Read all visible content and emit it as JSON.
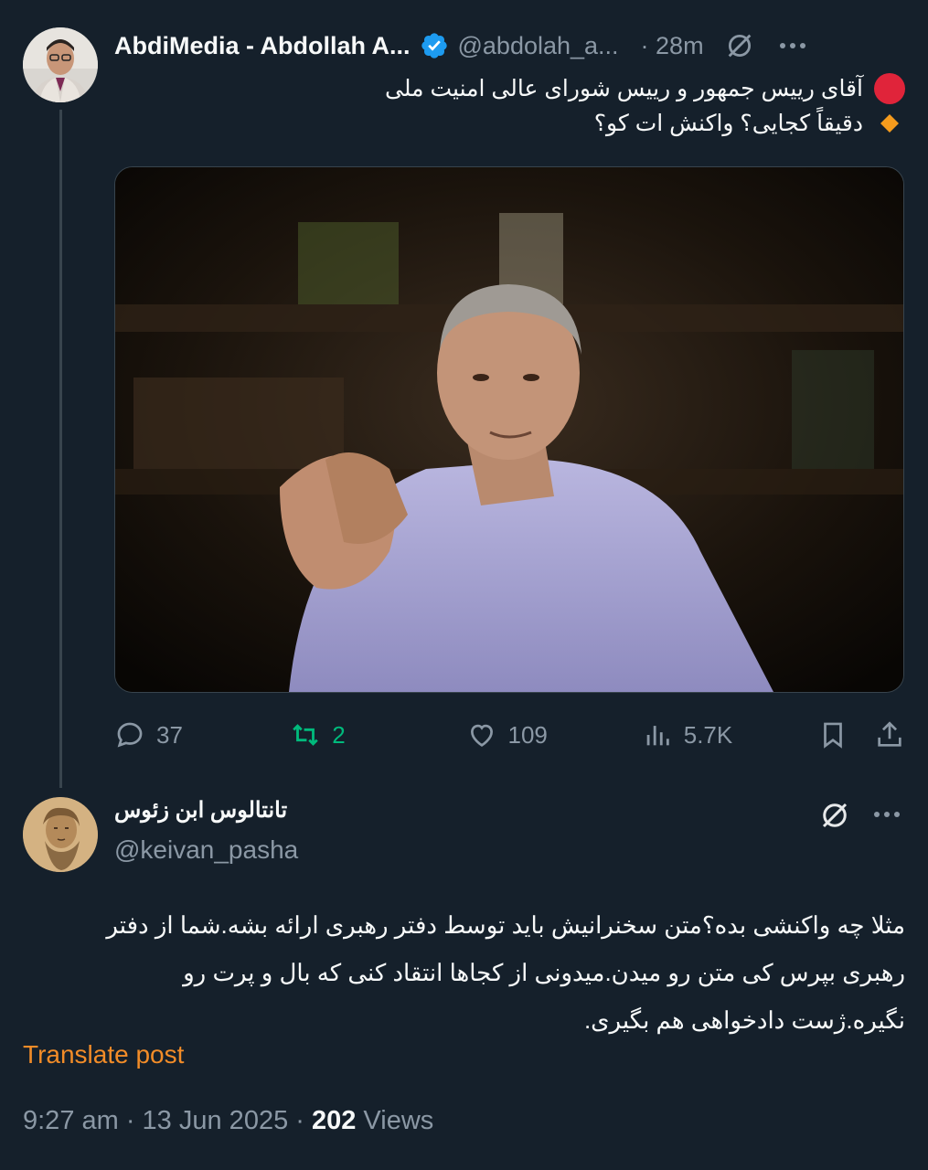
{
  "main_tweet": {
    "author_name": "AbdiMedia - Abdollah A...",
    "handle": "@abdolah_a...",
    "time": "· 28m",
    "lines": [
      {
        "emoji": "red-circle",
        "text": "آقای رییس جمهور و رییس شورای عالی امنیت ملی"
      },
      {
        "emoji": "orange-diamond",
        "text": "دقیقاً کجایی؟ واکنش ات کو؟"
      }
    ],
    "actions": {
      "replies": "37",
      "reposts": "2",
      "likes": "109",
      "views": "5.7K"
    }
  },
  "reply": {
    "author_name": "تانتالوس ابن زئوس",
    "handle": "@keivan_pasha",
    "lines": [
      "مثلا چه واکنشی بده؟متن سخنرانیش باید توسط دفتر رهبری ارائه بشه.شما از دفتر",
      "رهبری بپرس کی متن رو میدن.میدونی از کجاها انتقاد کنی که بال و پرت رو",
      "نگیره.ژست دادخواهی هم بگیری."
    ],
    "translate_label": "Translate post",
    "timestamp": "9:27 am · 13 Jun 2025 · ",
    "views_count": "202",
    "views_label": " Views"
  },
  "colors": {
    "background": "#15202b",
    "text": "#f7f9f9",
    "muted": "#8b98a5",
    "verified": "#1d9bf0",
    "repost_active": "#00ba7c",
    "translate": "#f28c28"
  }
}
